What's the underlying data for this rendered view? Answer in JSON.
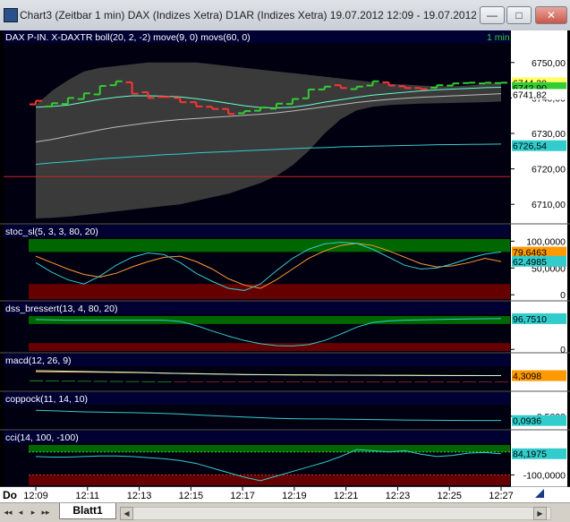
{
  "window": {
    "title": "Chart3 (Zeitbar 1 min)  DAX (Indizes Xetra) D1AR (Indizes Xetra) 19.07.2012 12:09 - 19.07.2012 12...",
    "min_label": "—",
    "max_label": "□",
    "close_label": "✕"
  },
  "sheet": {
    "tab_label": "Blatt1",
    "nav": [
      "◂◂",
      "◂",
      "▸",
      "▸▸"
    ]
  },
  "chart_data": {
    "type": "line",
    "x_axis": {
      "day_label": "Do",
      "ticks": [
        "12:09",
        "12:11",
        "12:13",
        "12:15",
        "12:17",
        "12:19",
        "12:21",
        "12:23",
        "12:25",
        "12:27"
      ]
    },
    "panels": [
      {
        "name": "price",
        "header": "DAX P-IN.  X-DAXTR boll(20, 2, -2) move(9, 0) movs(60, 0)",
        "interval": "1 min",
        "ylim": [
          6705,
          6755
        ],
        "y_ticks": [
          "6750,00",
          "6740,00",
          "6730,00",
          "6720,00",
          "6710,00"
        ],
        "y_tick_values": [
          6750,
          6740,
          6730,
          6720,
          6710
        ],
        "hline": 6717.8,
        "price_bars": [
          {
            "o": 6738.2,
            "c": 6739.2,
            "color": "red"
          },
          {
            "o": 6737.6,
            "c": 6738.5,
            "color": "green"
          },
          {
            "o": 6738.3,
            "c": 6740.0,
            "color": "green"
          },
          {
            "o": 6739.7,
            "c": 6741.3,
            "color": "green"
          },
          {
            "o": 6741.0,
            "c": 6743.4,
            "color": "green"
          },
          {
            "o": 6743.6,
            "c": 6744.7,
            "color": "green"
          },
          {
            "o": 6744.4,
            "c": 6741.2,
            "color": "red"
          },
          {
            "o": 6741.6,
            "c": 6740.0,
            "color": "red"
          },
          {
            "o": 6740.3,
            "c": 6740.3,
            "color": "red"
          },
          {
            "o": 6740.0,
            "c": 6738.8,
            "color": "red"
          },
          {
            "o": 6738.8,
            "c": 6737.6,
            "color": "red"
          },
          {
            "o": 6737.5,
            "c": 6736.9,
            "color": "red"
          },
          {
            "o": 6736.9,
            "c": 6735.5,
            "color": "red"
          },
          {
            "o": 6735.7,
            "c": 6736.3,
            "color": "green"
          },
          {
            "o": 6736.4,
            "c": 6737.3,
            "color": "green"
          },
          {
            "o": 6737.0,
            "c": 6738.4,
            "color": "green"
          },
          {
            "o": 6738.3,
            "c": 6739.7,
            "color": "green"
          },
          {
            "o": 6739.9,
            "c": 6742.4,
            "color": "green"
          },
          {
            "o": 6742.4,
            "c": 6743.2,
            "color": "green"
          },
          {
            "o": 6743.6,
            "c": 6742.8,
            "color": "red"
          },
          {
            "o": 6742.5,
            "c": 6743.2,
            "color": "green"
          },
          {
            "o": 6743.5,
            "c": 6744.7,
            "color": "green"
          },
          {
            "o": 6744.4,
            "c": 6743.5,
            "color": "red"
          },
          {
            "o": 6743.3,
            "c": 6742.8,
            "color": "red"
          },
          {
            "o": 6742.8,
            "c": 6742.5,
            "color": "red"
          },
          {
            "o": 6742.9,
            "c": 6743.6,
            "color": "green"
          },
          {
            "o": 6743.5,
            "c": 6744.1,
            "color": "green"
          },
          {
            "o": 6744.2,
            "c": 6744.3,
            "color": "green"
          },
          {
            "o": 6744.1,
            "c": 6744.3,
            "color": "green"
          },
          {
            "o": 6744.2,
            "c": 6744.3,
            "color": "green"
          }
        ],
        "boll_upper": [
          6738,
          6742,
          6745,
          6747.5,
          6748.5,
          6749,
          6749.5,
          6750,
          6750,
          6750,
          6750,
          6749.5,
          6749,
          6748.5,
          6748,
          6747.5,
          6747,
          6746.5,
          6746,
          6745.5,
          6745,
          6744.5,
          6744,
          6743.8,
          6743.5,
          6743.3,
          6743.3,
          6743.5,
          6744,
          6744.5
        ],
        "boll_lower": [
          6706,
          6706.2,
          6706.5,
          6707,
          6707.5,
          6708,
          6708.5,
          6709,
          6709.5,
          6710,
          6711,
          6712,
          6713,
          6714.5,
          6716,
          6718,
          6721,
          6725,
          6730,
          6734,
          6736.5,
          6737.5,
          6738,
          6738.2,
          6738.4,
          6738.5,
          6738.6,
          6738.7,
          6738.8,
          6739
        ],
        "move_ma": [
          6737.4,
          6737.6,
          6738.0,
          6738.8,
          6739.6,
          6740.2,
          6740.6,
          6740.6,
          6740.5,
          6740.3,
          6739.8,
          6739.2,
          6738.5,
          6737.8,
          6737.3,
          6737.2,
          6737.4,
          6738.0,
          6738.8,
          6739.5,
          6740.2,
          6740.8,
          6741.2,
          6741.6,
          6742.0,
          6742.3,
          6742.5,
          6742.7,
          6742.9,
          6743.0
        ],
        "movs_ma": [
          6727.6,
          6728.3,
          6729.2,
          6730.1,
          6731.0,
          6731.8,
          6732.4,
          6733.0,
          6733.5,
          6733.9,
          6734.2,
          6734.5,
          6734.8,
          6735.1,
          6735.4,
          6735.8,
          6736.3,
          6736.9,
          6737.5,
          6738.1,
          6738.7,
          6739.2,
          6739.6,
          6739.9,
          6740.2,
          6740.4,
          6740.6,
          6740.8,
          6741.0,
          6741.2
        ],
        "long_ma": [
          6721.3,
          6721.7,
          6722.0,
          6722.4,
          6722.8,
          6723.1,
          6723.4,
          6723.7,
          6724.0,
          6724.2,
          6724.5,
          6724.7,
          6724.9,
          6725.1,
          6725.3,
          6725.5,
          6725.7,
          6725.9,
          6726.0,
          6726.2,
          6726.3,
          6726.4,
          6726.5,
          6726.6,
          6726.7,
          6726.8,
          6726.85,
          6726.9,
          6726.95,
          6727.0
        ],
        "value_labels": [
          {
            "text": "6744,30",
            "value": 6744.3,
            "bg": "#ffff66",
            "fg": "#000"
          },
          {
            "text": "6742,90",
            "value": 6742.9,
            "bg": "#33cc33",
            "fg": "#000"
          },
          {
            "text": "6741,82",
            "value": 6741.0,
            "bg": "#ffffff",
            "fg": "#000"
          },
          {
            "text": "6726,54",
            "value": 6726.54,
            "bg": "#33cccc",
            "fg": "#000"
          }
        ]
      },
      {
        "name": "stoc_sl",
        "header": "stoc_sl(5, 3, 3, 80, 20)",
        "ylim": [
          -8,
          104
        ],
        "y_ticks": [
          "100,0000",
          "50,0000",
          "0"
        ],
        "y_tick_values": [
          100,
          50,
          0
        ],
        "band_high": 80,
        "band_low": 20,
        "k_line": [
          60,
          42,
          28,
          20,
          35,
          55,
          70,
          78,
          75,
          60,
          40,
          25,
          12,
          8,
          20,
          45,
          68,
          85,
          95,
          98,
          96,
          85,
          70,
          55,
          48,
          50,
          58,
          68,
          76,
          80
        ],
        "d_line": [
          72,
          60,
          48,
          38,
          33,
          40,
          52,
          62,
          70,
          72,
          62,
          48,
          30,
          18,
          12,
          28,
          48,
          68,
          82,
          92,
          96,
          92,
          82,
          70,
          58,
          52,
          54,
          60,
          68,
          62
        ],
        "value_labels": [
          {
            "text": "79,6463",
            "value": 79.6,
            "bg": "#ff9900",
            "fg": "#000"
          },
          {
            "text": "62,4985",
            "value": 62.5,
            "bg": "#33cccc",
            "fg": "#000"
          }
        ]
      },
      {
        "name": "dss_bressert",
        "header": "dss_bressert(13, 4, 80, 20)",
        "ylim": [
          -5,
          105
        ],
        "y_ticks": [
          "0"
        ],
        "y_tick_values": [
          0
        ],
        "band_high": 80,
        "band_low": 20,
        "line": [
          94,
          93,
          92,
          92,
          92,
          92,
          92,
          92,
          92,
          88,
          75,
          58,
          42,
          28,
          18,
          12,
          11,
          15,
          28,
          48,
          70,
          85,
          90,
          92,
          93,
          94,
          95,
          96,
          96.5,
          96.75
        ],
        "value_labels": [
          {
            "text": "96,7510",
            "value": 96.75,
            "bg": "#33cccc",
            "fg": "#000"
          }
        ]
      },
      {
        "name": "macd",
        "header": "macd(12, 26, 9)",
        "ylim": [
          -6,
          10
        ],
        "y_ticks": [],
        "y_tick_values": [],
        "macd_line": [
          8.0,
          7.8,
          7.6,
          7.4,
          7.2,
          7.0,
          6.8,
          6.5,
          6.2,
          5.9,
          5.7,
          5.5,
          5.3,
          5.1,
          5.0,
          4.9,
          4.8,
          4.8,
          4.7,
          4.7,
          4.6,
          4.6,
          4.5,
          4.5,
          4.4,
          4.4,
          4.35,
          4.33,
          4.31,
          4.3
        ],
        "signal_line": [
          7.2,
          7.1,
          7.0,
          6.9,
          6.8,
          6.7,
          6.6,
          6.4,
          6.2,
          6.0,
          5.8,
          5.6,
          5.4,
          5.2,
          5.1,
          5.0,
          4.9,
          4.85,
          4.8,
          4.75,
          4.7,
          4.65,
          4.6,
          4.55,
          4.5,
          4.45,
          4.4,
          4.38,
          4.35,
          4.33
        ],
        "histogram": [
          0.8,
          0.7,
          0.6,
          0.5,
          0.4,
          0.3,
          0.2,
          0.1,
          0,
          -0.1,
          -0.1,
          -0.1,
          -0.1,
          -0.1,
          -0.1,
          -0.1,
          -0.1,
          -0.05,
          -0.1,
          -0.05,
          -0.1,
          -0.05,
          -0.1,
          -0.05,
          -0.1,
          -0.05,
          -0.05,
          -0.05,
          -0.04,
          -0.03
        ],
        "value_labels": [
          {
            "text": "4,3098",
            "value": 4.3098,
            "bg": "#ff9900",
            "fg": "#000"
          }
        ]
      },
      {
        "name": "coppock",
        "header": "coppock(11, 14, 10)",
        "ylim": [
          -0.6,
          1.4
        ],
        "y_ticks": [
          "0,5000"
        ],
        "y_tick_values": [
          0.5
        ],
        "line": [
          1.05,
          1.0,
          0.95,
          0.9,
          0.88,
          0.85,
          0.83,
          0.8,
          0.75,
          0.7,
          0.62,
          0.55,
          0.48,
          0.42,
          0.36,
          0.3,
          0.26,
          0.24,
          0.24,
          0.22,
          0.2,
          0.18,
          0.16,
          0.14,
          0.13,
          0.12,
          0.11,
          0.1,
          0.095,
          0.0936
        ],
        "value_labels": [
          {
            "text": "0,0936",
            "value": 0.0936,
            "bg": "#33cccc",
            "fg": "#000"
          }
        ]
      },
      {
        "name": "cci",
        "header": "cci(14, 100, -100)",
        "ylim": [
          -190,
          160
        ],
        "y_ticks": [
          "-100,0000"
        ],
        "y_tick_values": [
          -100
        ],
        "band_high": 100,
        "band_low": -100,
        "line": [
          60,
          55,
          55,
          60,
          65,
          65,
          60,
          50,
          40,
          25,
          0,
          -40,
          -80,
          -120,
          -150,
          -110,
          -70,
          -30,
          10,
          60,
          120,
          110,
          100,
          110,
          80,
          60,
          70,
          90,
          95,
          84.2
        ],
        "value_labels": [
          {
            "text": "84,1975",
            "value": 84.2,
            "bg": "#33cccc",
            "fg": "#000"
          }
        ]
      }
    ]
  }
}
